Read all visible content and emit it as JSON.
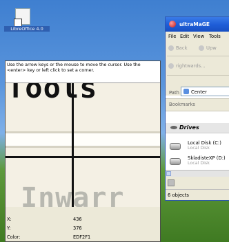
{
  "desktop": {
    "icon_label": "LibreOffice 4.0"
  },
  "magnifier": {
    "instructions": "Use the arrow keys or the mouse to move the cursor. Use the <enter> key or left click to set a corner.",
    "zoom_text_top": "Tools",
    "zoom_text_bottom": "Inwarr",
    "readout": {
      "x_label": "X:",
      "x_value": "436",
      "y_label": "Y:",
      "y_value": "376",
      "color_label": "Color:",
      "color_value": "EDF2F1"
    }
  },
  "app": {
    "title": "ultraMaGE",
    "menu": [
      "File",
      "Edit",
      "View",
      "Tools"
    ],
    "back_label": "Back",
    "up_label": "Upw",
    "address_hint": "rightwards...",
    "path_label": "Path",
    "path_value": "Center",
    "bookmarks_label": "Bookmarks",
    "drives_label": "Drives",
    "drives": [
      {
        "name": "Local Disk (C:)",
        "sub": "Local Disk"
      },
      {
        "name": "SkladisteXP (D:)",
        "sub": "Local Disk"
      }
    ],
    "status": "6 objects"
  },
  "colors": {
    "titlebar": "#1f5ed8",
    "crosshair": "#111111",
    "pixel_color": "#EDF2F1"
  }
}
